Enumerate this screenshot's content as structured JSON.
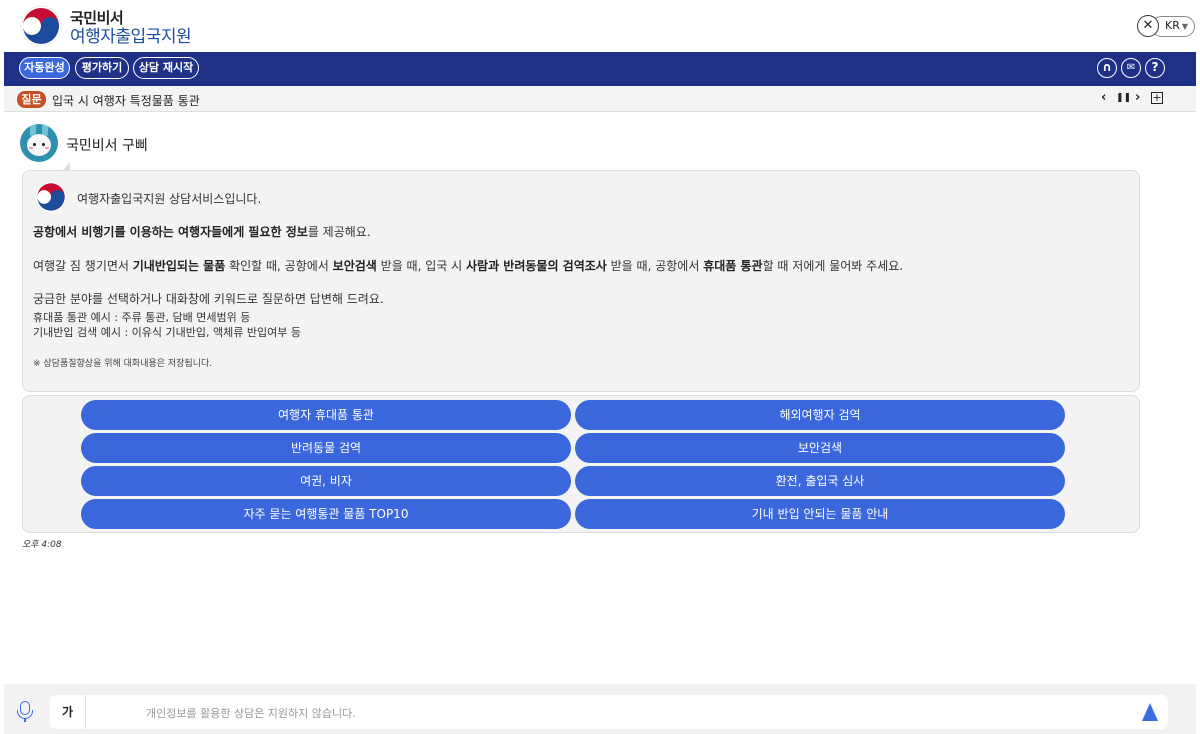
{
  "header": {
    "brand_top": "국민비서",
    "brand_main": "여행자출입국지원",
    "lang_close": "✕",
    "lang": "KR"
  },
  "toolbar": {
    "buttons": [
      {
        "label": "자동완성"
      },
      {
        "label": "평가하기"
      },
      {
        "label": "상담 재시작"
      }
    ],
    "icons": [
      {
        "name": "headset-icon",
        "glyph": "∩"
      },
      {
        "name": "mail-icon",
        "glyph": "✉"
      },
      {
        "name": "help-icon",
        "glyph": "?"
      }
    ]
  },
  "question": {
    "badge": "질문",
    "text": "입국 시 여행자 특정물품 통관",
    "prev": "‹",
    "pause": "❚❚",
    "next": "›",
    "expand": "+"
  },
  "bot": {
    "name": "국민비서 구삐"
  },
  "message": {
    "intro": "여행자출입국지원 상담서비스입니다.",
    "line1_b1": "공항에서 비행기를 이용하는 여행자들에게 필요한 정보",
    "line1_t1": "를 제공해요.",
    "line2_t1": "여행갈 짐 챙기면서 ",
    "line2_b1": "기내반입되는 물품",
    "line2_t2": " 확인할 때, 공항에서 ",
    "line2_b2": "보안검색",
    "line2_t3": " 받을 때, 입국 시 ",
    "line2_b3": "사람과 반려동물의 검역조사",
    "line2_t4": " 받을 때, 공항에서 ",
    "line2_b4": "휴대품 통관",
    "line2_t5": "할 때 저에게 물어봐 주세요.",
    "line3": "궁금한 분야를 선택하거나 대화창에 키워드로 질문하면 답변해 드려요.",
    "example1": "휴대품 통관 예시 : 주류 통관, 담배 면세범위 등",
    "example2": "기내반입 검색 예시 : 이유식 기내반입, 액체류 반입여부 등",
    "note": "※ 상담품질향상을 위해 대화내용은 저장됩니다."
  },
  "menu": [
    {
      "label": "여행자 휴대품 통관"
    },
    {
      "label": "해외여행자 검역"
    },
    {
      "label": "반려동물 검역"
    },
    {
      "label": "보안검색"
    },
    {
      "label": "여권, 비자"
    },
    {
      "label": "환전, 출입국 심사"
    },
    {
      "label": "자주 묻는 여행통관 물품 TOP10"
    },
    {
      "label": "기내 반입 안되는 물품 안내"
    }
  ],
  "timestamp": "오후 4:08",
  "input": {
    "key_label": "가",
    "placeholder": "개인정보를 활용한 상담은 지원하지 않습니다."
  },
  "colors": {
    "toolbar_bg": "#1e3187",
    "button_blue": "#3b67dc",
    "question_badge": "#c65129",
    "brand_blue": "#1d4c9d"
  }
}
